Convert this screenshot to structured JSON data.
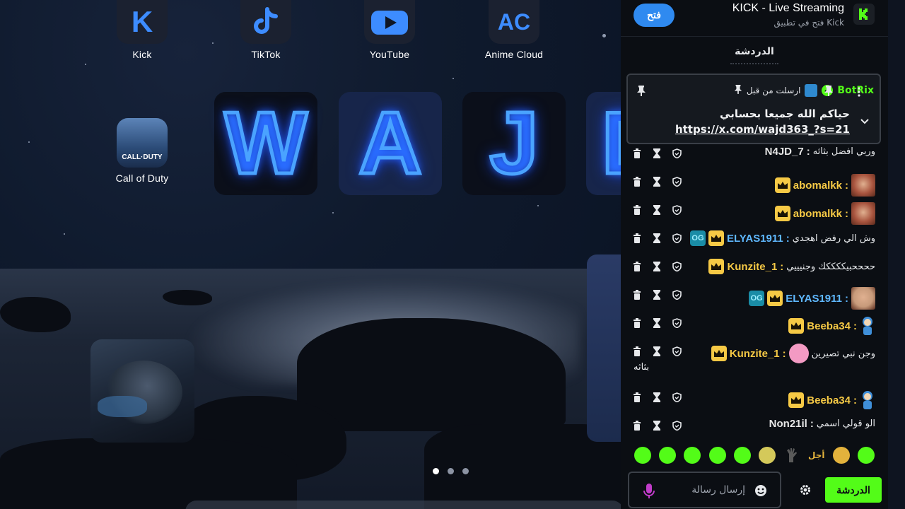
{
  "home": {
    "apps": [
      {
        "label": "Kick",
        "icon": "kick-icon"
      },
      {
        "label": "TikTok",
        "icon": "tiktok-icon"
      },
      {
        "label": "YouTube",
        "icon": "youtube-icon"
      },
      {
        "label": "Anime Cloud",
        "icon": "anime-cloud-icon"
      },
      {
        "label": "Call of Duty",
        "icon": "call-of-duty-icon"
      }
    ],
    "neon_tiles": [
      "W",
      "A",
      "J",
      "D"
    ],
    "kick_glyph": "K",
    "anime_glyph": "AC",
    "cod_glyph": "CALL·DUTY",
    "page_dots": 3,
    "active_dot": 0
  },
  "panel": {
    "open_button": "فتح",
    "app_title": "KICK - Live Streaming",
    "app_subtitle": "فتح في تطبيق Kick",
    "chat_tab": "الدردشة",
    "pinned": {
      "user": "BotRix",
      "sent_by": "ارسلت من قبل",
      "text": "حياكم الله جميعا بحسابي",
      "link": "https://x.com/wajd363_?s=21"
    },
    "messages": [
      {
        "user": "N4JD_7",
        "color": "#e6e6e6",
        "text": "وربي افضل بثاثه",
        "badges": [],
        "emote": ""
      },
      {
        "user": "abomalkk",
        "color": "#f6c945",
        "text": "",
        "badges": [
          "crown"
        ],
        "emote": "face"
      },
      {
        "user": "abomalkk",
        "color": "#f6c945",
        "text": "",
        "badges": [
          "crown"
        ],
        "emote": "face"
      },
      {
        "user": "ELYAS1911",
        "color": "#5fb8ff",
        "text": "وش الي رفض اهجدي",
        "badges": [
          "crown",
          "og"
        ],
        "emote": ""
      },
      {
        "user": "Kunzite_1",
        "color": "#f6c945",
        "text": "ححححبيككككك وجنيييي",
        "badges": [
          "crown"
        ],
        "emote": ""
      },
      {
        "user": "ELYAS1911",
        "color": "#5fb8ff",
        "text": "",
        "badges": [
          "crown",
          "og"
        ],
        "emote": "baby"
      },
      {
        "user": "Beeba34",
        "color": "#f6c945",
        "text": "",
        "badges": [
          "crown"
        ],
        "emote": "pocoyo"
      },
      {
        "user": "Kunzite_1",
        "color": "#f6c945",
        "text": "وجن نبي تصيرين",
        "text2": "بثاثه",
        "badges": [
          "crown"
        ],
        "emote": "pig"
      },
      {
        "user": "Beeba34",
        "color": "#f6c945",
        "text": "",
        "badges": [
          "crown"
        ],
        "emote": "pocoyo"
      },
      {
        "user": "Non21il",
        "color": "#e6e6e6",
        "text": "الو قولي اسمي",
        "badges": [],
        "emote": ""
      }
    ],
    "emote_bar_count": 10,
    "emote_bar_text": "أجل",
    "input_placeholder": "إرسال رسالة",
    "send_button": "الدردشة",
    "colors": {
      "kick_green": "#53fc18",
      "open_blue": "#2f8af0",
      "gold": "#f6c945"
    }
  }
}
